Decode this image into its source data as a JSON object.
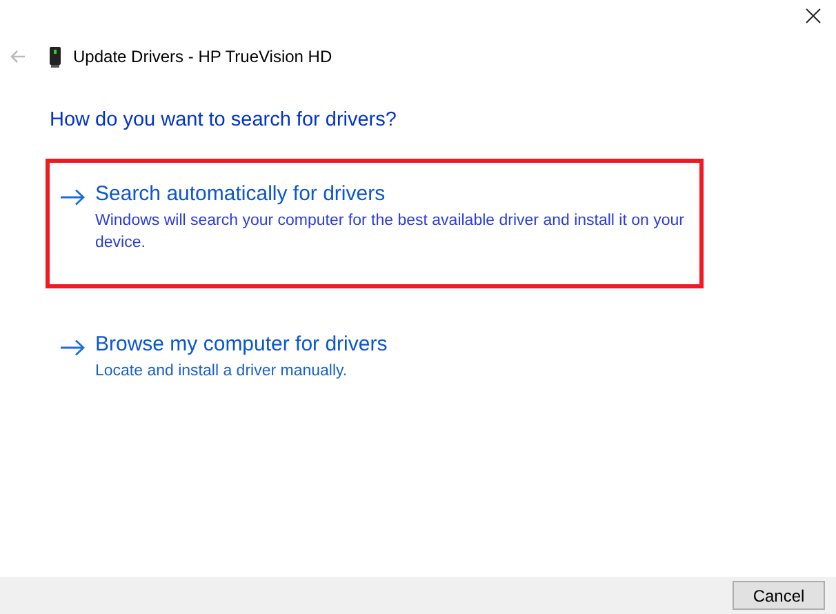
{
  "window": {
    "title": "Update Drivers - HP TrueVision HD",
    "back_disabled": true
  },
  "heading": "How do you want to search for drivers?",
  "options": [
    {
      "title": "Search automatically for drivers",
      "description": "Windows will search your computer for the best available driver and install it on your device.",
      "highlighted": true
    },
    {
      "title": "Browse my computer for drivers",
      "description": "Locate and install a driver manually.",
      "highlighted": false
    }
  ],
  "buttons": [
    "Cancel"
  ]
}
